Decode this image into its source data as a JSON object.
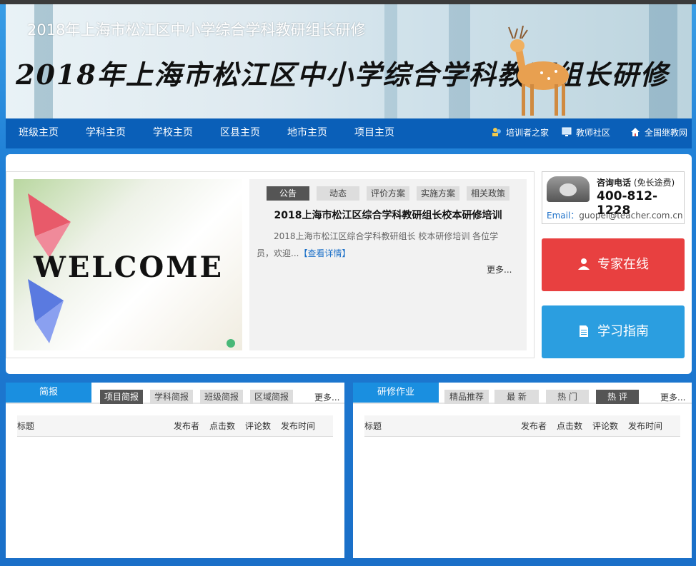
{
  "banner": {
    "small_title": "2018年上海市松江区中小学综合学科教研组长研修",
    "big_title": "2018年上海市松江区中小学综合学科教研组长研修"
  },
  "nav": {
    "items": [
      "班级主页",
      "学科主页",
      "学校主页",
      "区县主页",
      "地市主页",
      "项目主页"
    ],
    "right_links": [
      "培训者之家",
      "教师社区",
      "全国继教网"
    ]
  },
  "slider": {
    "welcome_text": "WELCOME"
  },
  "notice": {
    "tabs": [
      "公告",
      "动态",
      "评价方案",
      "实施方案",
      "相关政策"
    ],
    "active_tab": "公告",
    "title": "2018上海市松江区综合学科教研组长校本研修培训",
    "excerpt": "2018上海市松江区综合学科教研组长 校本研修培训 各位学员，欢迎...",
    "detail_link": "【查看详情】",
    "more": "更多..."
  },
  "contact": {
    "label": "咨询电话",
    "label_note": "(免长途费)",
    "phone": "400-812-1228",
    "email_label": "Email：",
    "email": "guopei@teacher.com.cn"
  },
  "buttons": {
    "expert": "专家在线",
    "guide": "学习指南"
  },
  "briefing": {
    "header": "简报",
    "tabs": [
      "项目简报",
      "学科简报",
      "班级简报",
      "区域简报"
    ],
    "active_tab": "项目简报",
    "more": "更多...",
    "columns": [
      "标题",
      "发布者",
      "点击数",
      "评论数",
      "发布时间"
    ]
  },
  "homework": {
    "header": "研修作业",
    "tabs": [
      "精品推荐",
      "最 新",
      "热 门",
      "热 评"
    ],
    "active_tab": "热 评",
    "more": "更多...",
    "columns": [
      "标题",
      "发布者",
      "点击数",
      "评论数",
      "发布时间"
    ]
  },
  "colors": {
    "nav_bg": "#0a5fb8",
    "expert_btn": "#e84040",
    "guide_btn": "#2b9ee0",
    "tab_blue": "#1a8fe0",
    "active_tab": "#555555"
  }
}
